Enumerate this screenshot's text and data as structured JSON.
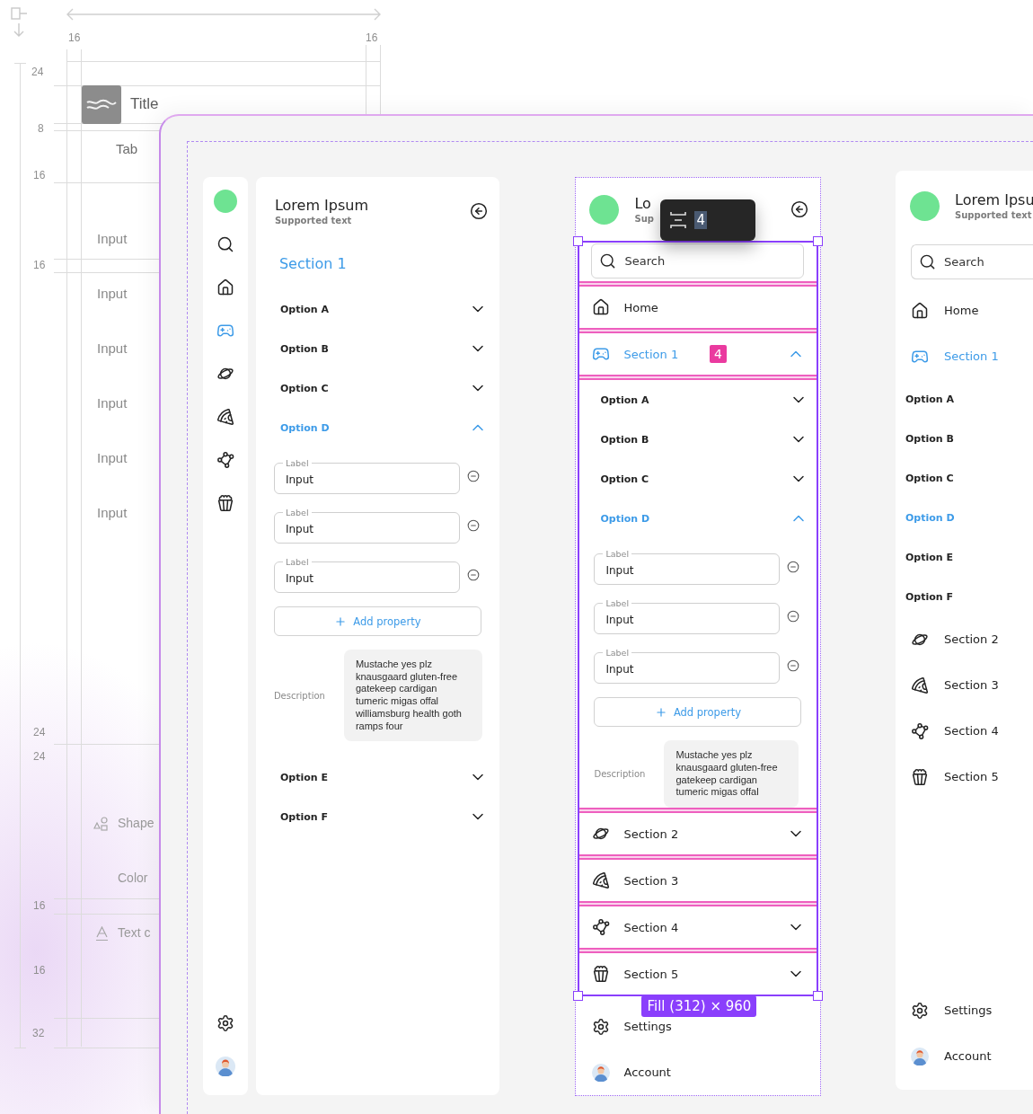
{
  "spec_sheet": {
    "measurements": [
      "16",
      "16",
      "24",
      "8",
      "16",
      "16",
      "24",
      "24",
      "16",
      "16",
      "32"
    ],
    "title": "Title",
    "tab": "Tab",
    "inputs": [
      "Input",
      "Input",
      "Input",
      "Input",
      "Input",
      "Input"
    ],
    "items": [
      {
        "label": "Shape",
        "kind": "shapes"
      },
      {
        "label": "Color",
        "kind": "plain"
      },
      {
        "label": "Text c",
        "kind": "letter"
      }
    ]
  },
  "rail": {
    "items": [
      {
        "selected": false
      },
      {
        "selected": false
      },
      {
        "selected": true
      },
      {
        "selected": false
      },
      {
        "selected": false
      },
      {
        "selected": false
      },
      {
        "selected": false
      }
    ]
  },
  "detail_panel": {
    "title": "Lorem Ipsum",
    "subtitle": "Supported text",
    "section": "Section 1",
    "options": [
      {
        "label": "Option A",
        "selected": false,
        "expandable": true,
        "expanded": false
      },
      {
        "label": "Option B",
        "selected": false,
        "expandable": true,
        "expanded": false
      },
      {
        "label": "Option C",
        "selected": false,
        "expandable": true,
        "expanded": false
      },
      {
        "label": "Option D",
        "selected": true,
        "expandable": true,
        "expanded": true,
        "fields": [
          {
            "label": "Label",
            "value": "Input"
          },
          {
            "label": "Label",
            "value": "Input"
          },
          {
            "label": "Label",
            "value": "Input"
          }
        ],
        "add_button": "Add property",
        "description": {
          "label": "Description",
          "text": "Mustache yes plz knausgaard gluten-free gatekeep cardigan tumeric migas offal williamsburg health goth ramps four"
        }
      },
      {
        "label": "Option E",
        "selected": false,
        "expandable": true,
        "expanded": false
      },
      {
        "label": "Option F",
        "selected": false,
        "expandable": true,
        "expanded": false
      }
    ]
  },
  "selected_panel": {
    "title": "Lo",
    "subtitle": "Sup",
    "search": {
      "placeholder": "Search"
    },
    "nav": [
      {
        "label": "Home",
        "selected": false,
        "expandable": false
      },
      {
        "label": "Section 1",
        "selected": true,
        "expandable": true,
        "expanded": true,
        "badge": "4",
        "children": [
          {
            "label": "Option A",
            "selected": false,
            "expandable": true,
            "expanded": false
          },
          {
            "label": "Option B",
            "selected": false,
            "expandable": true,
            "expanded": false
          },
          {
            "label": "Option C",
            "selected": false,
            "expandable": true,
            "expanded": false
          },
          {
            "label": "Option D",
            "selected": true,
            "expandable": true,
            "expanded": true,
            "fields": [
              {
                "label": "Label",
                "value": "Input"
              },
              {
                "label": "Label",
                "value": "Input"
              },
              {
                "label": "Label",
                "value": "Input"
              }
            ],
            "add_button": "Add property",
            "description": {
              "label": "Description",
              "text": "Mustache yes plz knausgaard gluten-free gatekeep cardigan tumeric migas offal"
            }
          }
        ]
      },
      {
        "label": "Section 2",
        "selected": false,
        "expandable": true,
        "expanded": false
      },
      {
        "label": "Section 3",
        "selected": false,
        "expandable": false
      },
      {
        "label": "Section 4",
        "selected": false,
        "expandable": true,
        "expanded": false
      },
      {
        "label": "Section 5",
        "selected": false,
        "expandable": true,
        "expanded": false
      }
    ],
    "footer": [
      {
        "label": "Settings"
      },
      {
        "label": "Account"
      }
    ]
  },
  "nav_panel": {
    "title": "Lorem Ipsu",
    "subtitle": "Supported text",
    "search": {
      "placeholder": "Search"
    },
    "nav": [
      {
        "label": "Home",
        "selected": false
      },
      {
        "label": "Section 1",
        "selected": true,
        "children": [
          {
            "label": "Option A",
            "selected": false
          },
          {
            "label": "Option B",
            "selected": false
          },
          {
            "label": "Option C",
            "selected": false
          },
          {
            "label": "Option D",
            "selected": true
          },
          {
            "label": "Option E",
            "selected": false
          },
          {
            "label": "Option F",
            "selected": false
          }
        ]
      },
      {
        "label": "Section 2",
        "selected": false
      },
      {
        "label": "Section 3",
        "selected": false
      },
      {
        "label": "Section 4",
        "selected": false
      },
      {
        "label": "Section 5",
        "selected": false
      }
    ],
    "footer": [
      {
        "label": "Settings"
      },
      {
        "label": "Account"
      }
    ]
  },
  "spacing_tooltip": {
    "value": "4"
  },
  "size_label": "Fill (312) × 960"
}
